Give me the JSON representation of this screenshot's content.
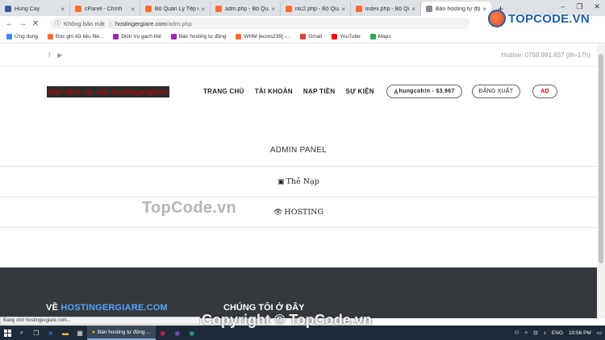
{
  "browser": {
    "tabs": [
      {
        "title": "Hùng Cay",
        "color": "#3b5998",
        "active": false
      },
      {
        "title": "cPanel - Chính",
        "color": "#ff6c2c",
        "active": false
      },
      {
        "title": "Bộ Quản Lý Tệp c",
        "color": "#ff6c2c",
        "active": false
      },
      {
        "title": "adm.php - Bộ Quả",
        "color": "#ff6c2c",
        "active": false
      },
      {
        "title": "ntc2.php - Bộ Quả",
        "color": "#ff6c2c",
        "active": false
      },
      {
        "title": "index.php - Bộ Qu",
        "color": "#ff6c2c",
        "active": false
      },
      {
        "title": "Bán hosting tự độ",
        "color": "#888888",
        "active": true
      }
    ],
    "new_tab": "+",
    "window_controls": [
      "–",
      "❐",
      "✕"
    ],
    "back": "←",
    "forward": "→",
    "reload": "✕",
    "address": {
      "security_icon": "ⓘ",
      "security_text": "Không bảo mật",
      "separator": "|",
      "host": "hostingergiare.com",
      "path": "/adm.php"
    },
    "bookmarks": [
      {
        "label": "Ứng dụng",
        "color": "#4285f4"
      },
      {
        "label": "Đọc ghi dữ liệu file...",
        "color": "#ff6c2c"
      },
      {
        "label": "Dịch Vụ gạch thẻ",
        "color": "#9c27b0"
      },
      {
        "label": "Bán hosting tự động",
        "color": "#9c27b0"
      },
      {
        "label": "WHM [ecres239] -...",
        "color": "#ff6c2c"
      },
      {
        "label": "Gmail",
        "color": "#db4437"
      },
      {
        "label": "YouTube",
        "color": "#ff0000"
      },
      {
        "label": "Maps",
        "color": "#34a853"
      }
    ],
    "status_text": "Đang chờ hostingergiare.com..."
  },
  "site": {
    "social": [
      "f",
      "▶"
    ],
    "hotline": "Hotline: 0768.991.837 (8h-17h)",
    "logo_text": "Mọi dịch vụ của hostingergiare",
    "nav": [
      "TRANG CHỦ",
      "TÀI KHOẢN",
      "NẠP TIỀN",
      "SỰ KIỆN"
    ],
    "user_pill": "hungcoh!n - $3.967",
    "user_icon": "♙",
    "logout": "ĐĂNG XUẤT",
    "avatar": "AD",
    "panel_title": "ADMIN PANEL",
    "rows": [
      {
        "icon": "▣",
        "label": "Thẻ Nạp"
      },
      {
        "icon": "👁",
        "label": "HOSTING"
      }
    ],
    "footer": {
      "col1_prefix": "VỀ ",
      "col1_brand": "HOSTINGERGIARE.COM",
      "col2": "CHÚNG TÔI Ở ĐÂY"
    }
  },
  "taskbar": {
    "search_icon": "⌕",
    "app_label": "Bán hosting tự động ...",
    "tray_lang": "ENG",
    "time": "10:56 PM"
  },
  "watermarks": {
    "logo": "TOPCODE.VN",
    "center": "TopCode.vn",
    "bottom": "Copyright © TopCode.vn"
  },
  "colors": {
    "footer_bg": "#35393d",
    "brand_blue": "#4ea4ff",
    "avatar_red": "#cc0000"
  }
}
